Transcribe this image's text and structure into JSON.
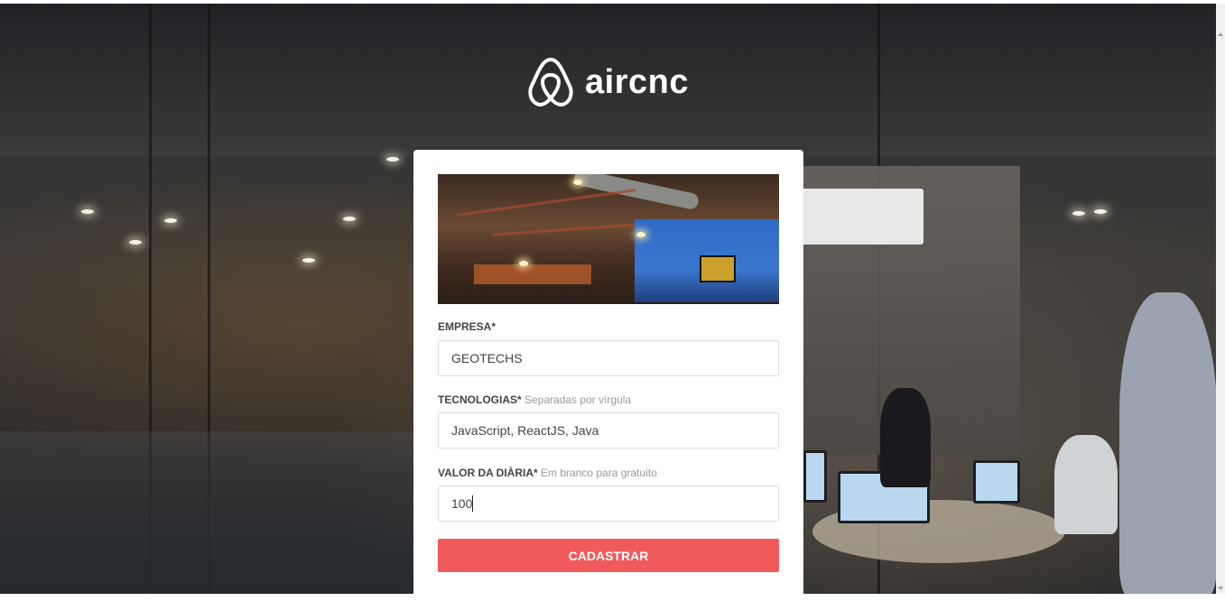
{
  "app": {
    "logo_text": "aircnc"
  },
  "form": {
    "empresa": {
      "label": "EMPRESA*",
      "value": "GEOTECHS"
    },
    "tecnologias": {
      "label": "TECNOLOGIAS*",
      "hint": "Separadas por vírgula",
      "value": "JavaScript, ReactJS, Java"
    },
    "valor": {
      "label": "VALOR DA DIÀRIA*",
      "hint": "Em branco para gratuito",
      "value": "100"
    },
    "submit_label": "CADASTRAR"
  },
  "colors": {
    "accent": "#f05a5b",
    "card": "#ffffff",
    "label": "#444444",
    "hint": "#999999"
  },
  "icons": {
    "logo": "airbnb-belo-icon"
  }
}
